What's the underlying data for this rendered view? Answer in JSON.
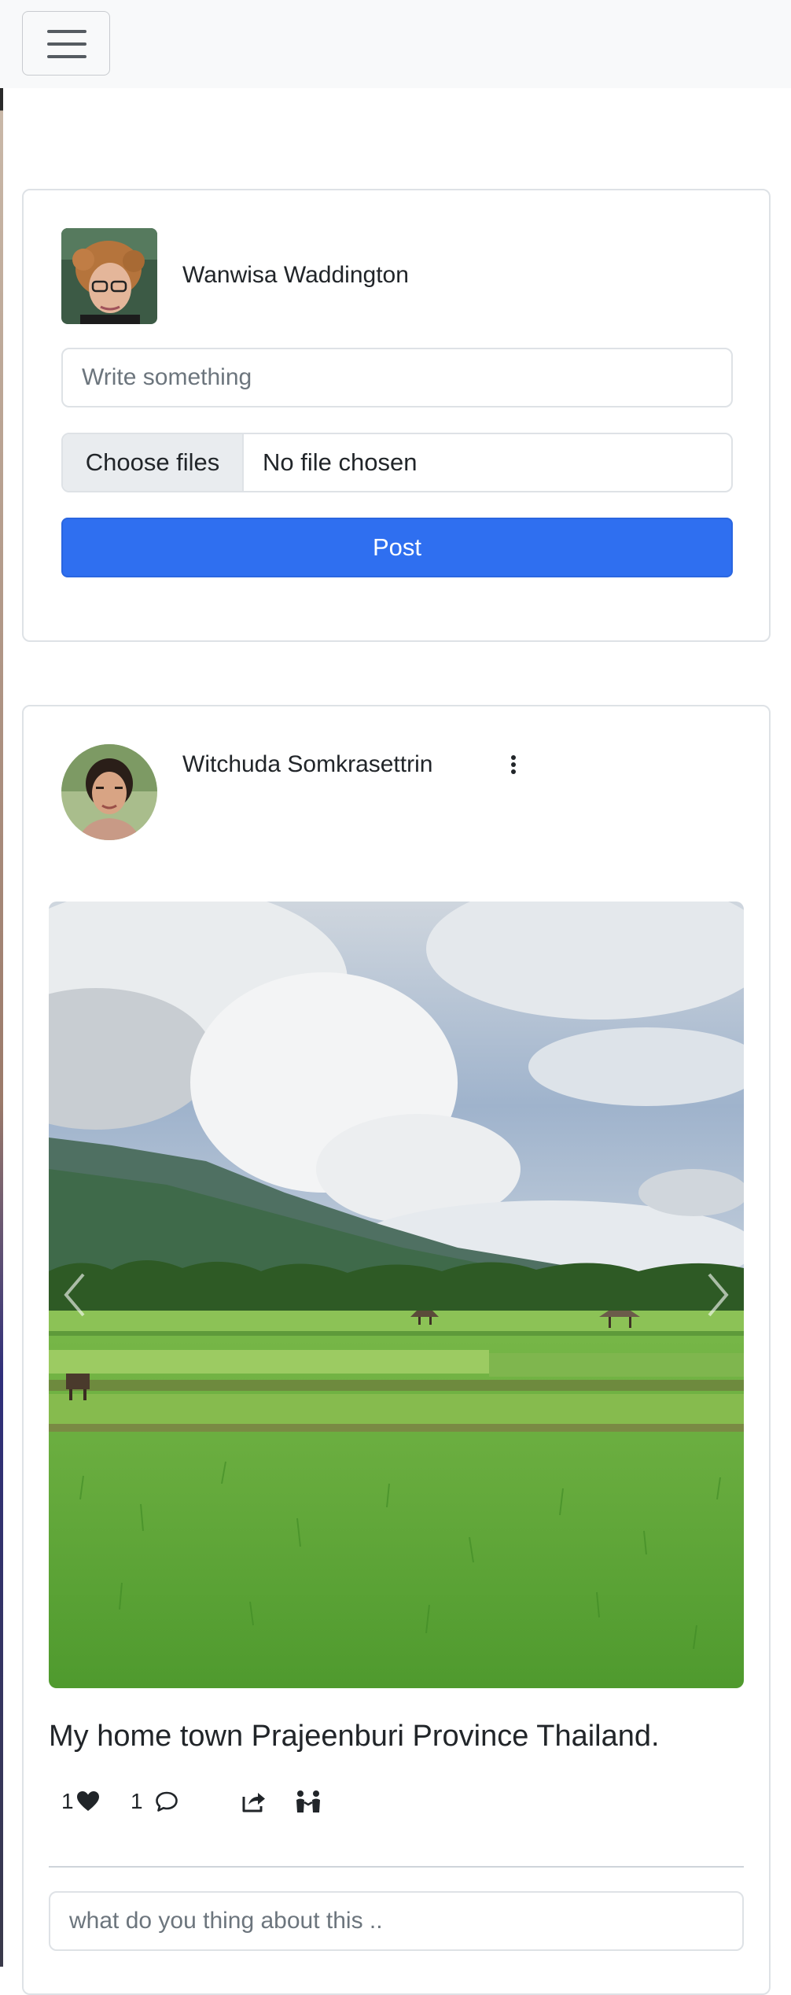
{
  "navbar": {
    "toggle_icon": "hamburger-menu-icon"
  },
  "composer": {
    "user_name": "Wanwisa Waddington",
    "text_placeholder": "Write something",
    "file_button_label": "Choose files",
    "file_status": "No file chosen",
    "post_button_label": "Post",
    "button_color": "#2f6ff0"
  },
  "post": {
    "author_name": "Witchuda Somkrasettrin",
    "menu_icon": "vertical-ellipsis-icon",
    "caption": "My home town Prajeenburi Province Thailand.",
    "likes_count": "1",
    "comments_count": "1",
    "comment_placeholder": "what do you thing about this ..",
    "icons": [
      "heart-icon",
      "comment-icon",
      "share-icon",
      "people-icon",
      "chevron-left-icon",
      "chevron-right-icon"
    ]
  }
}
